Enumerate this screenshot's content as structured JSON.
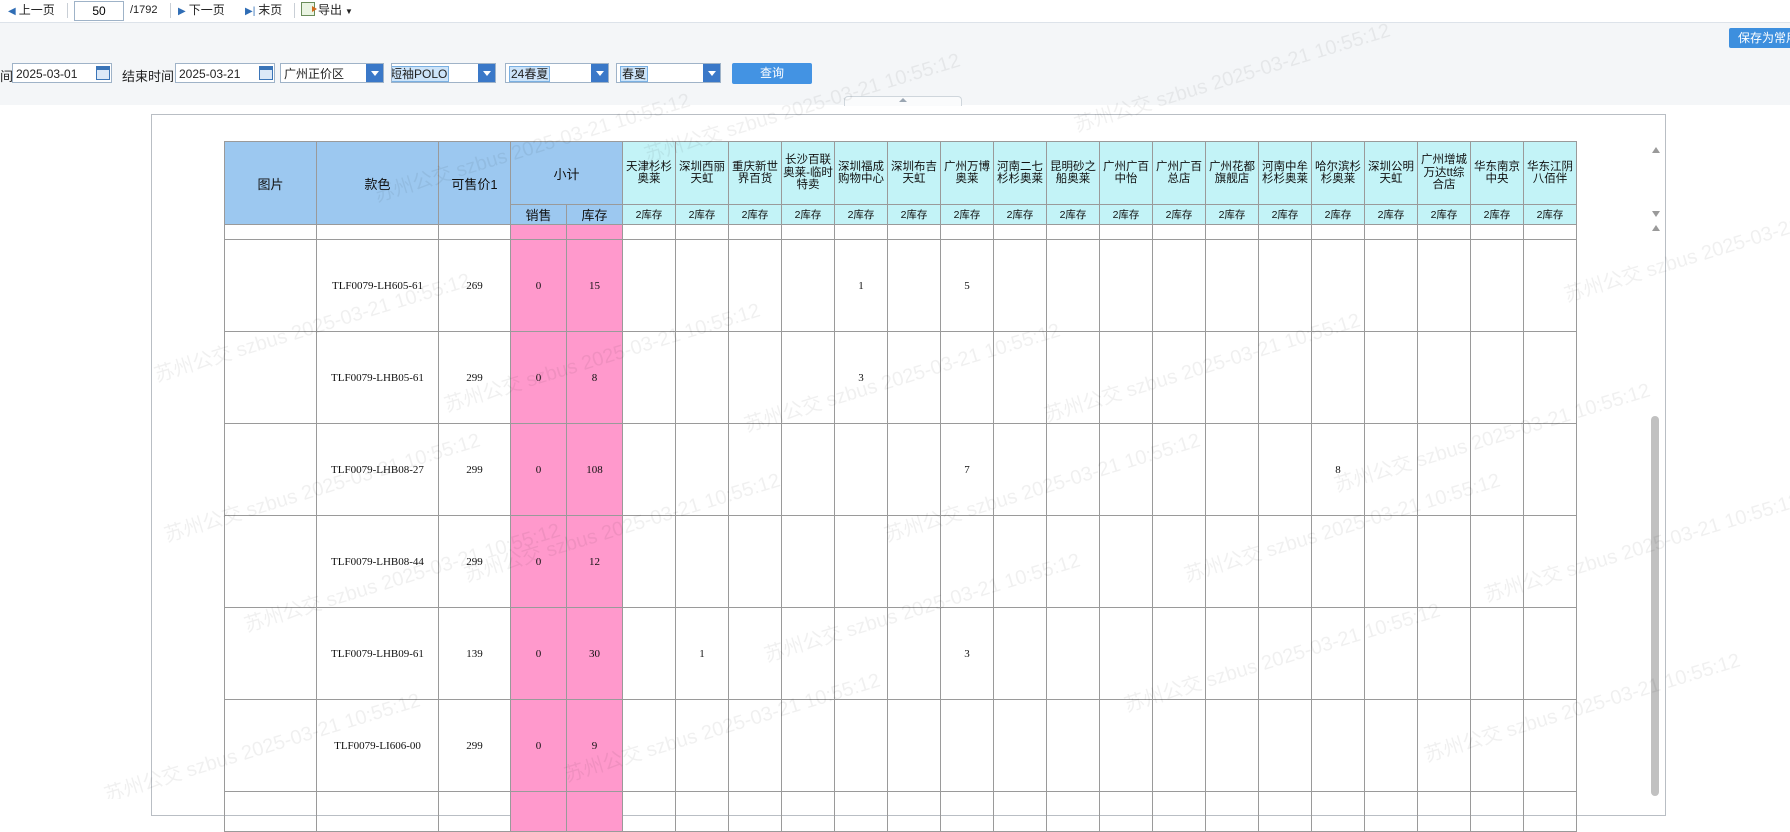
{
  "toolbar": {
    "prev_label": "上一页",
    "page_value": "50",
    "page_total": "/1792",
    "next_label": "下一页",
    "last_label": "末页",
    "export_label": "导出"
  },
  "save_label": "保存为常用",
  "filters": {
    "start_label_partial": "间",
    "start_date": "2025-03-01",
    "end_label": "结束时间",
    "end_date": "2025-03-21",
    "region": "广州正价区",
    "category": "短袖POLO",
    "season_year": "24春夏",
    "season": "春夏",
    "query_label": "查询"
  },
  "table": {
    "col_image": "图片",
    "col_sku": "款色",
    "col_price": "可售价1",
    "col_subtotal": "小计",
    "col_sales": "销售",
    "col_stock": "库存",
    "store_sub_label": "2库存",
    "stores": [
      "天津杉杉奥莱",
      "深圳西丽天虹",
      "重庆新世界百货",
      "长沙百联奥莱-临时特卖",
      "深圳福成购物中心",
      "深圳布吉天虹",
      "广州万博奥莱",
      "河南二七杉杉奥莱",
      "昆明砂之船奥莱",
      "广州广百中怡",
      "广州广百总店",
      "广州花都旗舰店",
      "河南中牟杉杉奥莱",
      "哈尔滨杉杉奥莱",
      "深圳公明天虹",
      "广州增城万达tt综合店",
      "华东南京中央",
      "华东江阴八佰伴"
    ],
    "rows": [
      {
        "sku": "TLF0079-LH605-61",
        "price": "269",
        "sales": "0",
        "stock": "15",
        "stores": [
          "",
          "",
          "",
          "",
          "1",
          "",
          "5",
          "",
          "",
          "",
          "",
          "",
          "",
          "",
          "",
          "",
          "",
          ""
        ]
      },
      {
        "sku": "TLF0079-LHB05-61",
        "price": "299",
        "sales": "0",
        "stock": "8",
        "stores": [
          "",
          "",
          "",
          "",
          "3",
          "",
          "",
          "",
          "",
          "",
          "",
          "",
          "",
          "",
          "",
          "",
          "",
          ""
        ]
      },
      {
        "sku": "TLF0079-LHB08-27",
        "price": "299",
        "sales": "0",
        "stock": "108",
        "stores": [
          "",
          "",
          "",
          "",
          "",
          "",
          "7",
          "",
          "",
          "",
          "",
          "",
          "",
          "8",
          "",
          "",
          "",
          ""
        ]
      },
      {
        "sku": "TLF0079-LHB08-44",
        "price": "299",
        "sales": "0",
        "stock": "12",
        "stores": [
          "",
          "",
          "",
          "",
          "",
          "",
          "",
          "",
          "",
          "",
          "",
          "",
          "",
          "",
          "",
          "",
          "",
          ""
        ]
      },
      {
        "sku": "TLF0079-LHB09-61",
        "price": "139",
        "sales": "0",
        "stock": "30",
        "stores": [
          "",
          "1",
          "",
          "",
          "",
          "",
          "3",
          "",
          "",
          "",
          "",
          "",
          "",
          "",
          "",
          "",
          "",
          ""
        ]
      },
      {
        "sku": "TLF0079-LI606-00",
        "price": "299",
        "sales": "0",
        "stock": "9",
        "stores": [
          "",
          "",
          "",
          "",
          "",
          "",
          "",
          "",
          "",
          "",
          "",
          "",
          "",
          "",
          "",
          "",
          "",
          ""
        ]
      }
    ]
  },
  "watermark_text": "苏州公交 szbus 2025-03-21 10:55:12",
  "colors": {
    "header_blue": "#9cc8f0",
    "header_cyan": "#c3f3f7",
    "subtotal_pink": "#ff99cc",
    "button_blue": "#4393e3"
  }
}
